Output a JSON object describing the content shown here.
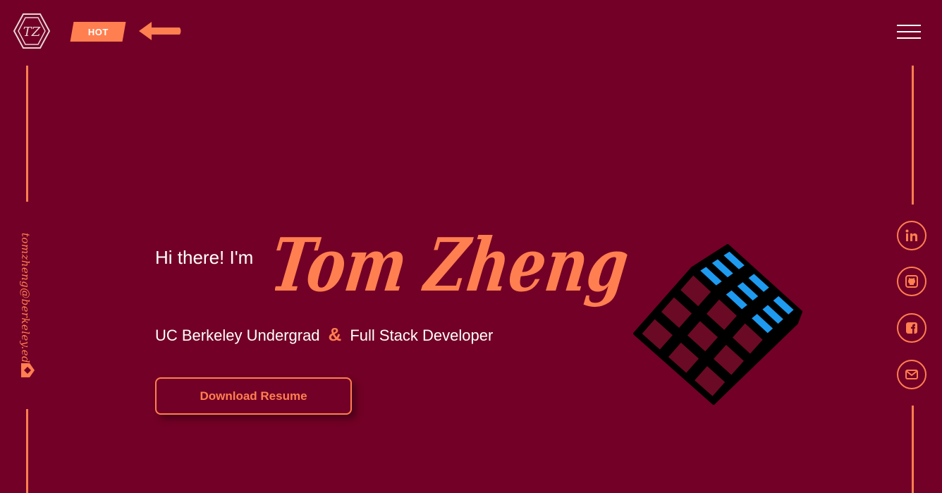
{
  "header": {
    "logo_text": "TZ",
    "hot_badge": "HOT",
    "menu_icon": "hamburger-menu-icon"
  },
  "sidebar_left": {
    "email": "tomzheng@berkeley.edu",
    "icon": "mail-tag-icon"
  },
  "sidebar_right": {
    "socials": [
      {
        "name": "linkedin",
        "icon": "linkedin-icon"
      },
      {
        "name": "github",
        "icon": "github-icon"
      },
      {
        "name": "facebook",
        "icon": "facebook-icon"
      },
      {
        "name": "email",
        "icon": "envelope-icon"
      }
    ]
  },
  "hero": {
    "greeting": "Hi there! I'm",
    "name": "Tom Zheng",
    "role_left": "UC Berkeley Undergrad",
    "ampersand": "&",
    "role_right": "Full Stack Developer",
    "resume_button": "Download Resume"
  },
  "colors": {
    "background": "#730026",
    "accent": "#ff7f50",
    "text": "#ffffff"
  }
}
